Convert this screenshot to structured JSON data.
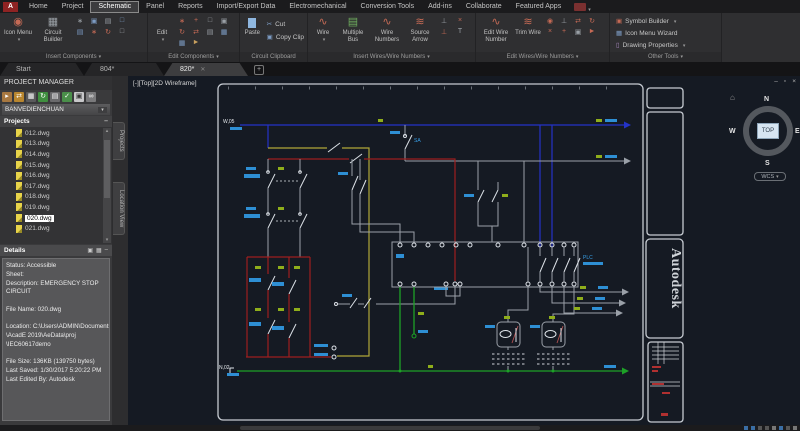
{
  "ribbon": {
    "logo": "A",
    "tabs": [
      {
        "label": "Home"
      },
      {
        "label": "Project"
      },
      {
        "label": "Schematic"
      },
      {
        "label": "Panel"
      },
      {
        "label": "Reports"
      },
      {
        "label": "Import/Export Data"
      },
      {
        "label": "Electromechanical"
      },
      {
        "label": "Conversion Tools"
      },
      {
        "label": "Add-ins"
      },
      {
        "label": "Collaborate"
      },
      {
        "label": "Featured Apps"
      }
    ],
    "active_tab": "Schematic",
    "panels": [
      {
        "label": "Insert Components",
        "buttons": {
          "icon_menu": "Icon Menu",
          "circuit_builder": "Circuit Builder"
        }
      },
      {
        "label": "Edit Components",
        "buttons": {
          "edit": "Edit"
        }
      },
      {
        "label": "Circuit Clipboard",
        "buttons": {
          "paste": "Paste",
          "cut": "Cut",
          "copy_clip": "Copy Clip"
        }
      },
      {
        "label": "Insert Wires/Wire Numbers",
        "buttons": {
          "wire": "Wire",
          "multiple_bus": "Multiple Bus",
          "wire_numbers": "Wire Numbers",
          "source_arrow": "Source Arrow"
        }
      },
      {
        "label": "Edit Wires/Wire Numbers",
        "buttons": {
          "edit_wire_number": "Edit Wire Number",
          "trim_wire": "Trim Wire"
        }
      },
      {
        "label": "Other Tools",
        "buttons": {
          "symbol_builder": "Symbol Builder",
          "icon_menu_wizard": "Icon Menu  Wizard",
          "drawing_properties": "Drawing  Properties"
        }
      }
    ]
  },
  "doc_tabs": {
    "tabs": [
      {
        "label": "Start"
      },
      {
        "label": "804*"
      },
      {
        "label": "820*"
      }
    ],
    "active": "820*",
    "new_tab": "+"
  },
  "project_manager": {
    "title": "PROJECT MANAGER",
    "project_name": "BANVEDIENCHUAN",
    "section": "Projects",
    "files": [
      {
        "name": "012.dwg"
      },
      {
        "name": "013.dwg"
      },
      {
        "name": "014.dwg"
      },
      {
        "name": "015.dwg"
      },
      {
        "name": "016.dwg"
      },
      {
        "name": "017.dwg"
      },
      {
        "name": "018.dwg"
      },
      {
        "name": "019.dwg"
      },
      {
        "name": "020.dwg"
      },
      {
        "name": "021.dwg"
      }
    ],
    "selected_file": "020.dwg",
    "details_title": "Details",
    "details_lines": [
      "Status: Accessible",
      "Sheet:",
      "Description: EMERGENCY STOP",
      "CIRCUIT",
      "",
      "File Name: 020.dwg",
      "",
      "Location: C:\\Users\\ADMIN\\Documents",
      "\\AcadE 2019\\AeData\\proj",
      "\\IEC60617demo",
      "",
      "File Size: 136KB (139750 bytes)",
      "Last Saved: 1/30/2017 5:20:22 PM",
      "Last Edited By: Autodesk"
    ],
    "side_tabs": [
      {
        "label": "Projects"
      },
      {
        "label": "Location View"
      }
    ]
  },
  "canvas": {
    "viewport_label": "[-][Top][2D Wireframe]",
    "viewcube": {
      "n": "N",
      "e": "E",
      "s": "S",
      "w": "W",
      "face": "TOP",
      "wcs": "WCS"
    },
    "sheet_brand": "Autodesk",
    "wire_labels": {
      "top_left": "W,05",
      "bottom_left": "N,02",
      "switch": "SA",
      "plc": "PLC"
    }
  },
  "colors": {
    "canvas_bg": "#151a23",
    "wire_blue": "#2433c8",
    "wire_red": "#9e1f1f",
    "wire_yellow": "#b0a838",
    "wire_green": "#1da127",
    "wire_gray": "#9aa0a8",
    "label_cyan": "#38a0e8",
    "label_green": "#8fae1b",
    "ribbon_bg": "#2f2f31",
    "panel_gray": "#575759",
    "selection": "#ffffff"
  }
}
